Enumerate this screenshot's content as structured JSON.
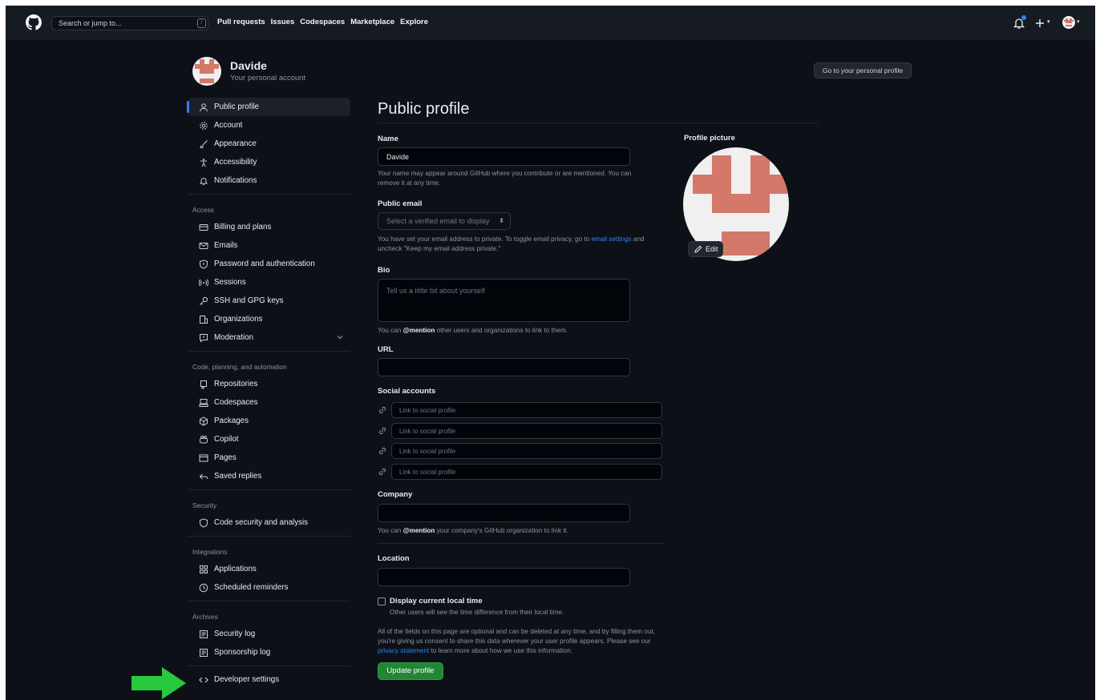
{
  "header": {
    "search_placeholder": "Search or jump to...",
    "search_shortcut": "/",
    "nav": [
      "Pull requests",
      "Issues",
      "Codespaces",
      "Marketplace",
      "Explore"
    ],
    "icons": [
      "github-logo-icon",
      "notifications-bell-icon",
      "plus-icon",
      "user-avatar-icon"
    ]
  },
  "account": {
    "name": "Davide",
    "subtitle": "Your personal account",
    "go_profile": "Go to your personal profile"
  },
  "sidebar": {
    "items": [
      {
        "label": "Public profile",
        "icon": "person-icon"
      },
      {
        "label": "Account",
        "icon": "gear-icon"
      },
      {
        "label": "Appearance",
        "icon": "paintbrush-icon"
      },
      {
        "label": "Accessibility",
        "icon": "accessibility-icon"
      },
      {
        "label": "Notifications",
        "icon": "bell-icon"
      }
    ],
    "access_label": "Access",
    "access": [
      {
        "label": "Billing and plans",
        "icon": "credit-card-icon"
      },
      {
        "label": "Emails",
        "icon": "mail-icon"
      },
      {
        "label": "Password and authentication",
        "icon": "shield-lock-icon"
      },
      {
        "label": "Sessions",
        "icon": "broadcast-icon"
      },
      {
        "label": "SSH and GPG keys",
        "icon": "key-icon"
      },
      {
        "label": "Organizations",
        "icon": "organization-icon"
      },
      {
        "label": "Moderation",
        "icon": "report-icon"
      }
    ],
    "code_label": "Code, planning, and automation",
    "code": [
      {
        "label": "Repositories",
        "icon": "repo-icon"
      },
      {
        "label": "Codespaces",
        "icon": "codespaces-icon"
      },
      {
        "label": "Packages",
        "icon": "package-icon"
      },
      {
        "label": "Copilot",
        "icon": "copilot-icon"
      },
      {
        "label": "Pages",
        "icon": "browser-icon"
      },
      {
        "label": "Saved replies",
        "icon": "reply-icon"
      }
    ],
    "security_label": "Security",
    "security": [
      {
        "label": "Code security and analysis",
        "icon": "shield-icon"
      }
    ],
    "integrations_label": "Integrations",
    "integrations": [
      {
        "label": "Applications",
        "icon": "apps-icon"
      },
      {
        "label": "Scheduled reminders",
        "icon": "clock-icon"
      }
    ],
    "archives_label": "Archives",
    "archives": [
      {
        "label": "Security log",
        "icon": "log-icon"
      },
      {
        "label": "Sponsorship log",
        "icon": "log-icon"
      }
    ],
    "developer": {
      "label": "Developer settings",
      "icon": "code-icon"
    }
  },
  "form": {
    "title": "Public profile",
    "name_label": "Name",
    "name_value": "Davide",
    "name_help": "Your name may appear around GitHub where you contribute or are mentioned. You can remove it at any time.",
    "email_label": "Public email",
    "email_placeholder": "Select a verified email to display",
    "email_help_1": "You have set your email address to private. To toggle email privacy, go to",
    "email_help_link": "email settings",
    "email_help_2": "and uncheck \"Keep my email address private.\"",
    "bio_label": "Bio",
    "bio_placeholder": "Tell us a little bit about yourself",
    "bio_help_1": "You can",
    "bio_help_bold": "@mention",
    "bio_help_2": "other users and organizations to link to them.",
    "url_label": "URL",
    "url_value": "",
    "social_label": "Social accounts",
    "social_placeholder": "Link to social profile",
    "company_label": "Company",
    "company_value": "",
    "company_help_1": "You can",
    "company_help_bold": "@mention",
    "company_help_2": "your company's GitHub organization to link it.",
    "location_label": "Location",
    "location_value": "",
    "time_label": "Display current local time",
    "time_help": "Other users will see the time difference from their local time.",
    "footer_1": "All of the fields on this page are optional and can be deleted at any time, and by filling them out, you're giving us consent to share this data wherever your user profile appears. Please see our",
    "footer_link": "privacy statement",
    "footer_2": "to learn more about how we use this information.",
    "update_button": "Update profile"
  },
  "picture": {
    "label": "Profile picture",
    "edit": "Edit"
  },
  "colors": {
    "background": "#0d1117",
    "header": "#161b22",
    "accent": "#2f81f7",
    "primary_button": "#238636",
    "avatar_pixel": "#d4786a",
    "arrow": "#27c93f"
  }
}
